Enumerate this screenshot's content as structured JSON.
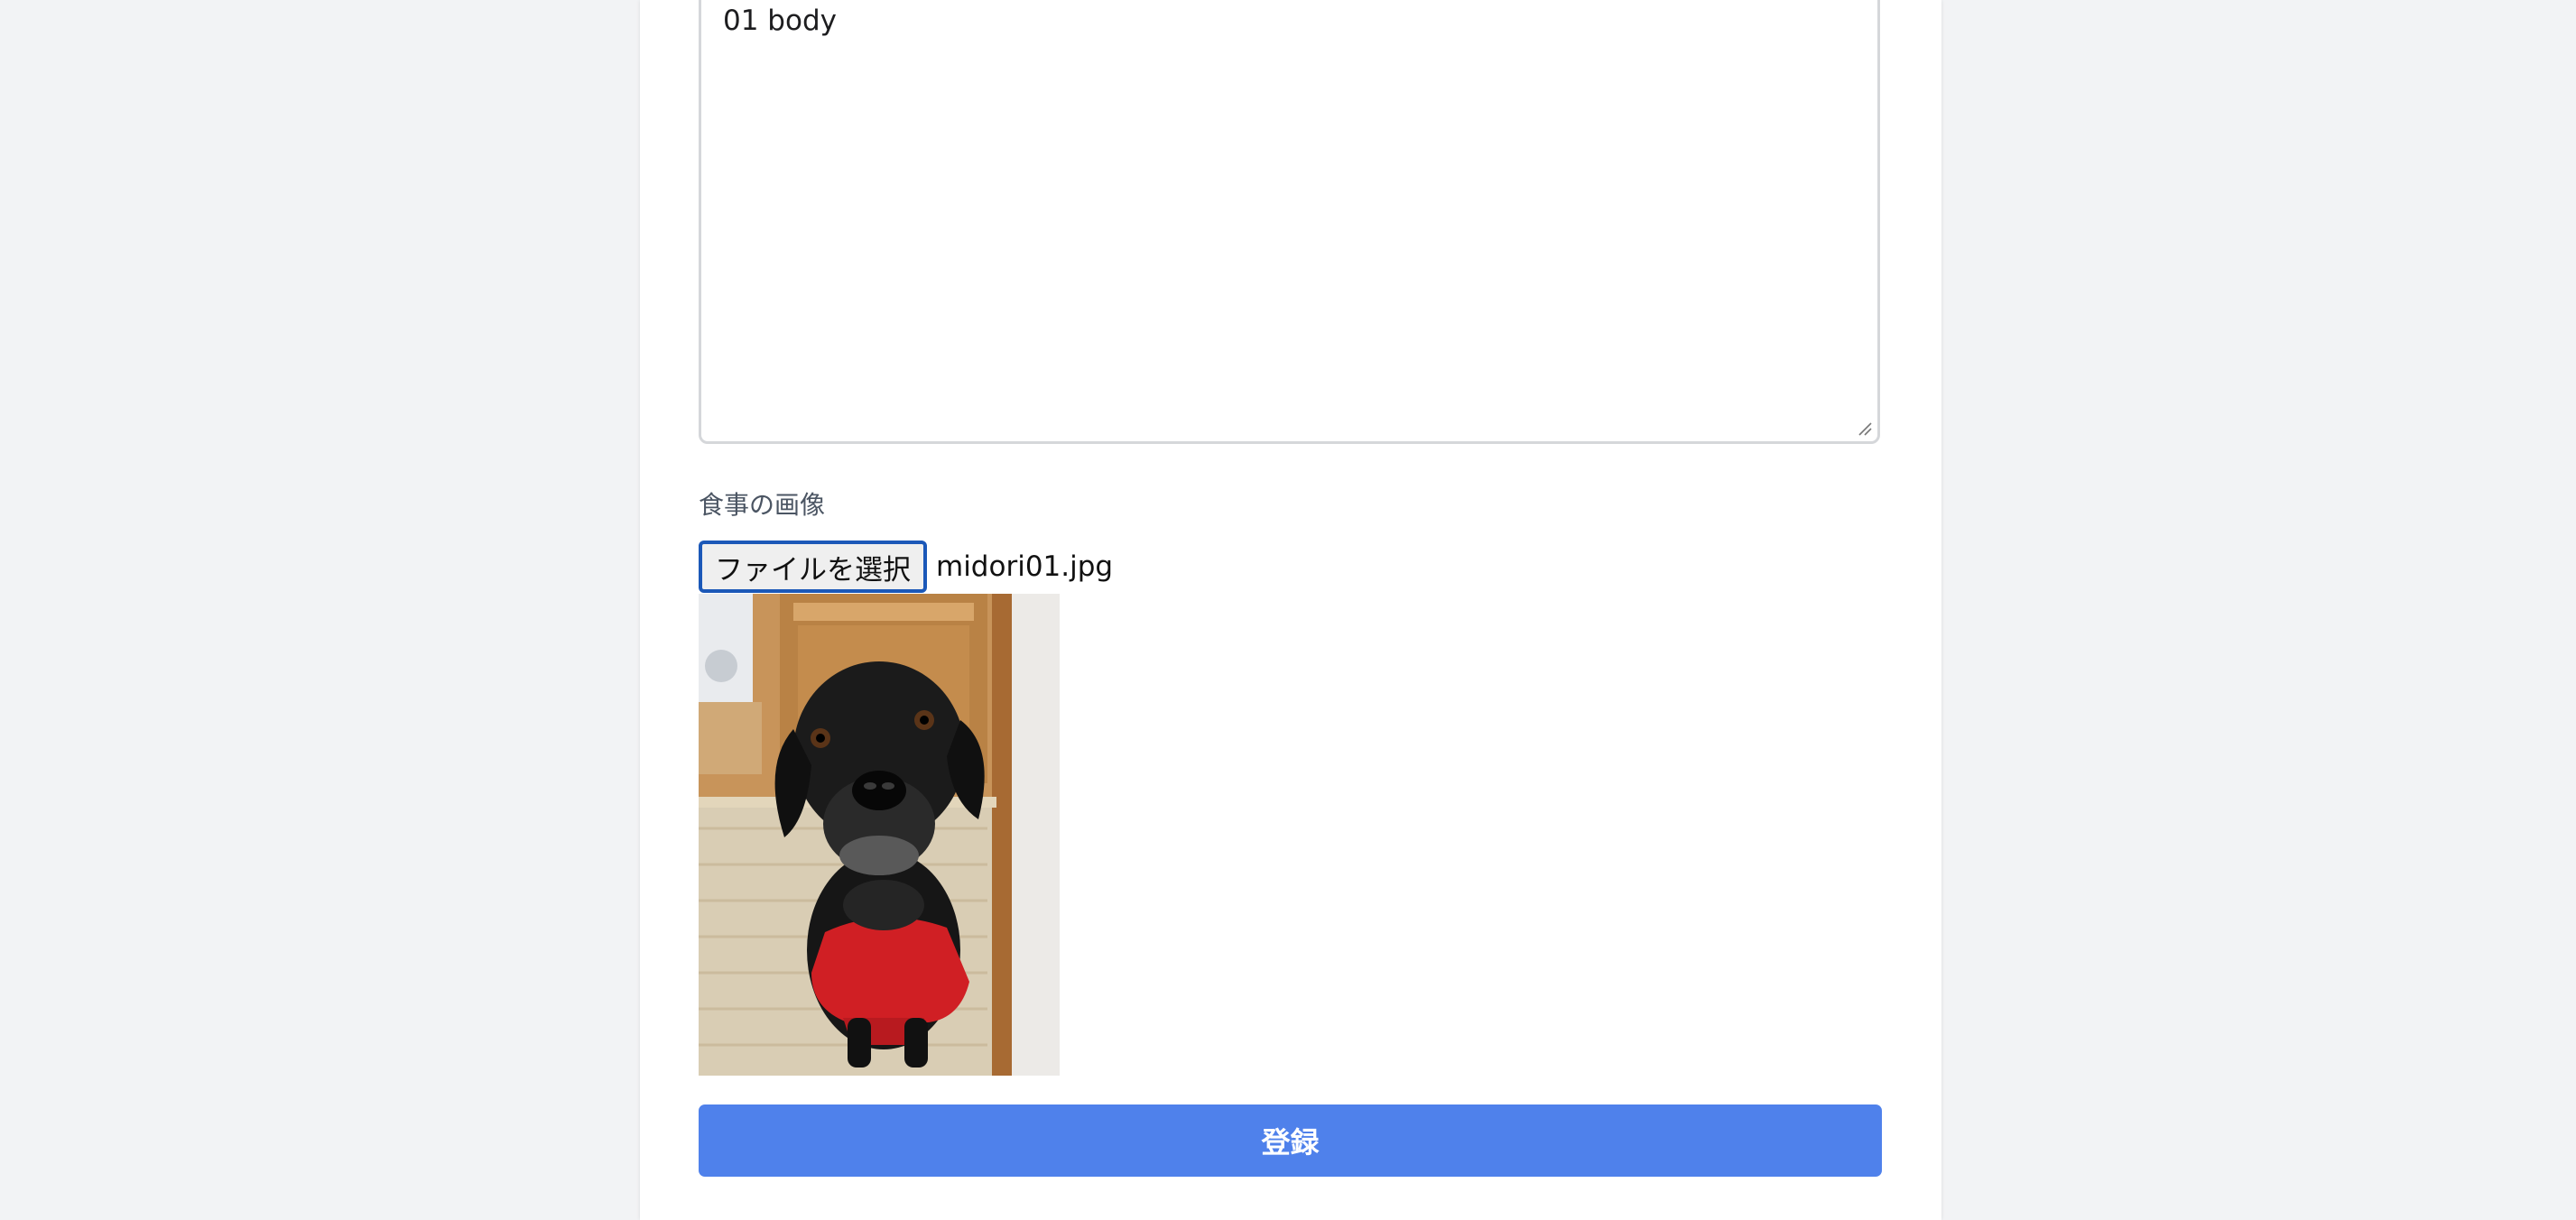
{
  "form": {
    "body_textarea": {
      "value": "01 body"
    },
    "image_field": {
      "label": "食事の画像",
      "file_button_label": "ファイルを選択",
      "selected_file": "midori01.jpg"
    },
    "submit_label": "登録"
  },
  "colors": {
    "page_background": "#f2f3f5",
    "card_background": "#ffffff",
    "primary_button": "#4f81eb",
    "file_button_border": "#1b58b8"
  }
}
